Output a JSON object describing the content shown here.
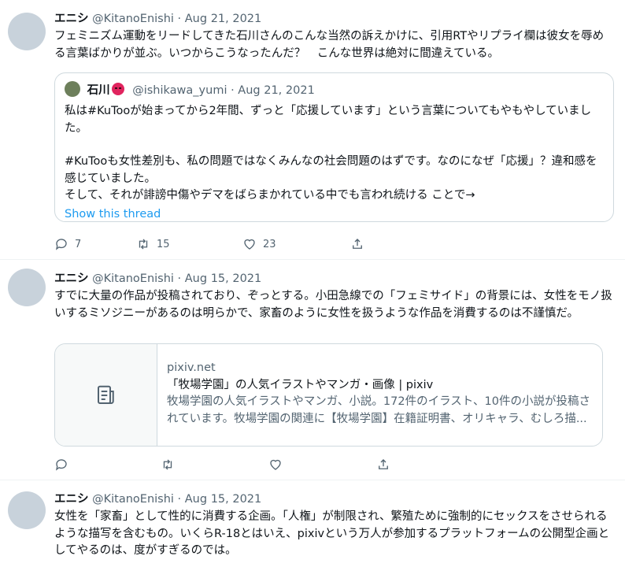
{
  "tweets": [
    {
      "name": "エニシ",
      "handle": "@KitanoEnishi",
      "date": "· Aug 21, 2021",
      "text": "フェミニズム運動をリードしてきた石川さんのこんな当然の訴えかけに、引用RTやリプライ欄は彼女を辱める言葉ばかりが並ぶ。いつからこうなったんだ？　こんな世界は絶対に間違えている。",
      "quote": {
        "name": "石川",
        "handle": "@ishikawa_yumi",
        "date": "· Aug 21, 2021",
        "text1": "私は#KuTooが始まってから2年間、ずっと「応援しています」という言葉についてもやもやしていました。",
        "text2": "#KuTooも女性差別も、私の問題ではなくみんなの社会問題のはずです。なのになぜ「応援」？違和感を感じていました。",
        "text3": "そして、それが誹謗中傷やデマをばらまかれている中でも言われ続ける ことで→",
        "link": "Show this thread"
      },
      "replies": "7",
      "retweets": "15",
      "likes": "23"
    },
    {
      "name": "エニシ",
      "handle": "@KitanoEnishi",
      "date": "· Aug 15, 2021",
      "text": "すでに大量の作品が投稿されており、ぞっとする。小田急線での「フェミサイド」の背景には、女性をモノ扱いするミソジニーがあるのは明らかで、家畜のように女性を扱うような作品を消費するのは不謹慎だ。",
      "card": {
        "domain": "pixiv.net",
        "title": "「牧場学園」の人気イラストやマンガ・画像 | pixiv",
        "desc": "牧場学園の人気イラストやマンガ、小説。172件のイラスト、10件の小説が投稿されています。牧場学園の関連に【牧場学園】在籍証明書、オリキャラ、むしろ描..."
      }
    },
    {
      "name": "エニシ",
      "handle": "@KitanoEnishi",
      "date": "· Aug 15, 2021",
      "text": "女性を「家畜」として性的に消費する企画。「人権」が制限され、繁殖ために強制的にセックスをさせられるような描写を含むもの。いくらR-18とはいえ、pixivという万人が参加するプラットフォームの公開型企画としてやるのは、度がすぎるのでは。"
    }
  ],
  "icons": [
    "reply-icon",
    "retweet-icon",
    "like-icon",
    "share-icon",
    "document-icon"
  ],
  "colors": {
    "link": "#1d9bf0",
    "secondary": "#536471",
    "border": "#cfd9de",
    "avatar": "#c8d2db"
  }
}
